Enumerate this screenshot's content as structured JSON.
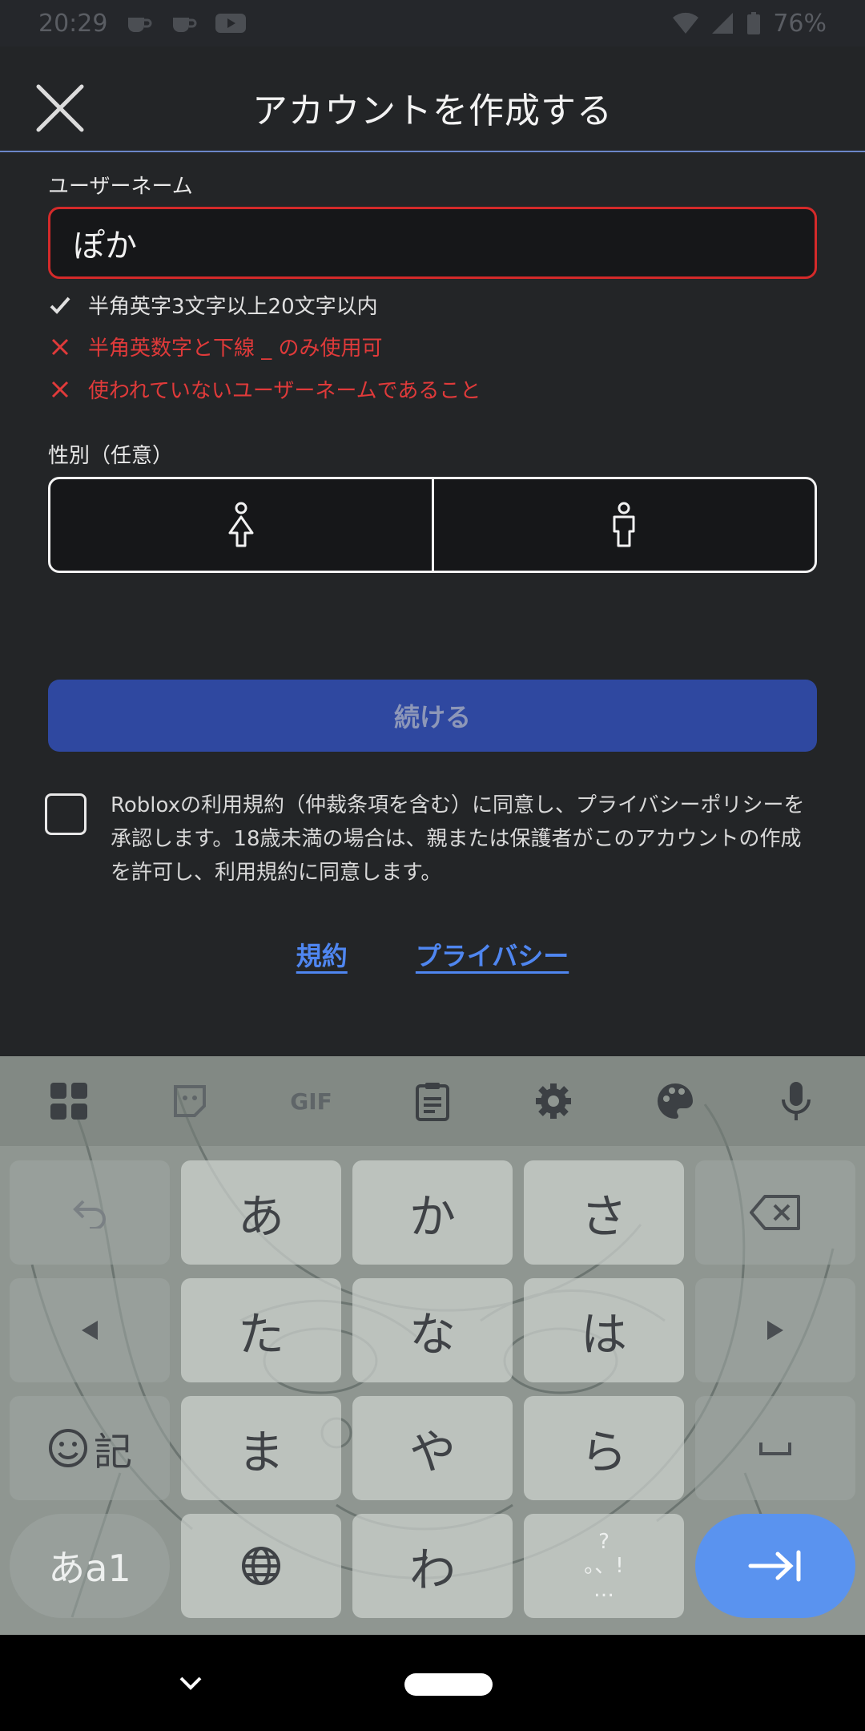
{
  "status_bar": {
    "time": "20:29",
    "battery": "76%"
  },
  "header": {
    "title": "アカウントを作成する"
  },
  "form": {
    "username_label": "ユーザーネーム",
    "username_value": "ぽか",
    "rules": [
      {
        "state": "ok",
        "text": "半角英字3文字以上20文字以内"
      },
      {
        "state": "bad",
        "text": "半角英数字と下線 _ のみ使用可"
      },
      {
        "state": "bad",
        "text": "使われていないユーザーネームであること"
      }
    ],
    "gender_label": "性別（任意）",
    "continue_label": "続ける",
    "terms_text": "Robloxの利用規約（仲裁条項を含む）に同意し、プライバシーポリシーを承認します。18歳未満の場合は、親または保護者がこのアカウントの作成を許可し、利用規約に同意します。",
    "link_terms": "規約",
    "link_privacy": "プライバシー"
  },
  "keyboard": {
    "toolbar": {
      "gif_label": "GIF"
    },
    "keys": {
      "a": "あ",
      "ka": "か",
      "sa": "さ",
      "ta": "た",
      "na": "な",
      "ha": "は",
      "ma": "ま",
      "ya": "や",
      "ra": "ら",
      "wa": "わ",
      "kigou": "記",
      "mode": "あa1",
      "punct_top": "?",
      "punct_mid": "。、!",
      "punct_bottom": "…"
    }
  },
  "colors": {
    "accent_blue": "#4f86f0",
    "error_red": "#e03a3a",
    "continue_bg": "#2f48a0"
  }
}
